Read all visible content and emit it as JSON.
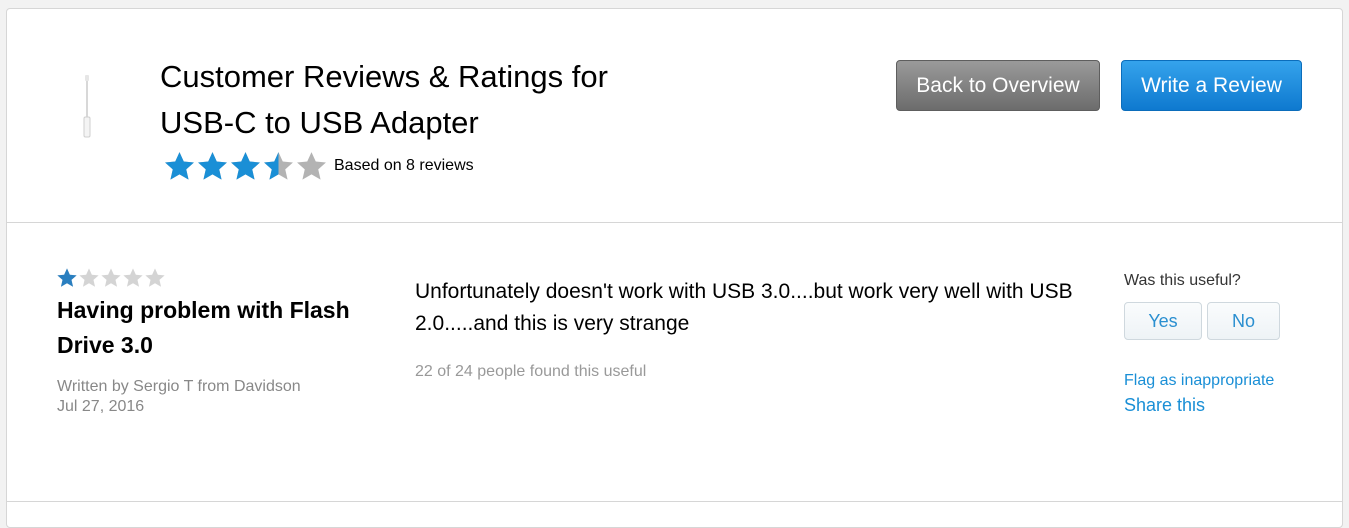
{
  "product": {
    "title_line1": "Customer Reviews & Ratings for",
    "title_line2": "USB-C to USB Adapter",
    "image_icon": "usb-adapter-thumbnail"
  },
  "summary": {
    "rating": 3.5,
    "max_rating": 5,
    "based_on": "Based on 8 reviews",
    "star_color": "#1a8fd6",
    "empty_star_color": "#b3b3b3"
  },
  "actions": {
    "back_label": "Back to Overview",
    "write_label": "Write a Review"
  },
  "reviews": [
    {
      "rating": 1,
      "title": "Having problem with Flash Drive 3.0",
      "author": "Written by Sergio T from Davidson",
      "date": "Jul 27, 2016",
      "body": "Unfortunately doesn't work with USB 3.0....but work very well with USB 2.0.....and this is very strange",
      "useful_count": "22 of 24 people found this useful",
      "useful_question": "Was this useful?",
      "yes_label": "Yes",
      "no_label": "No",
      "flag_label": "Flag as inappropriate",
      "share_label": "Share this"
    }
  ]
}
